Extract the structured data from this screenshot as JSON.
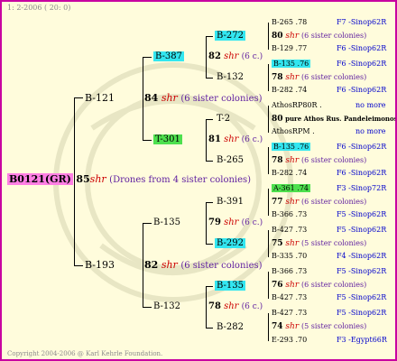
{
  "header": "1:  2-2006 ( 20: 0)",
  "footer": "Copyright 2004-2006 @ Karl Kehrle Foundation.",
  "root": {
    "name": "B0121(GR)",
    "year": "85",
    "shr": "shr",
    "note": "(Drones from 4 sister colonies)"
  },
  "gen1": {
    "top": {
      "id": "B-121",
      "year": "84",
      "shr": "shr",
      "note": "(6 sister colonies)"
    },
    "bottom": {
      "id": "B-193",
      "year": "82",
      "shr": "shr",
      "note": "(6 sister colonies)"
    }
  },
  "gen2": {
    "a": {
      "id": "B-387",
      "year": "82",
      "shr": "shr",
      "note": "(6 c.)"
    },
    "b": {
      "id": "T-301",
      "year": "81",
      "shr": "shr",
      "note": "(6 c.)"
    },
    "c": {
      "id": "B-135",
      "year": "79",
      "shr": "shr",
      "note": "(6 c.)"
    },
    "d": {
      "id": "B-132",
      "year": "78",
      "shr": "shr",
      "note": "(6 c.)"
    }
  },
  "gen3": {
    "a1": "B-272",
    "a2": "B-132",
    "b1": "T-2",
    "b2": "B-265",
    "c1": "B-391",
    "c2": "B-292",
    "d1": "B-135",
    "d2": "B-282"
  },
  "rows": [
    {
      "l": "B-265 .78",
      "r": "F7 -Sinop62R"
    },
    {
      "y": "80",
      "shr": "shr",
      "n": "(6 sister colonies)"
    },
    {
      "l": "B-129 .77",
      "r": "F6 -Sinop62R"
    },
    {
      "l": "B-135 .76",
      "r": "F6 -Sinop62R"
    },
    {
      "y": "78",
      "shr": "shr",
      "n": "(6 sister colonies)"
    },
    {
      "l": "B-282 .74",
      "r": "F6 -Sinop62R"
    },
    {
      "l": "AthosRP80R .",
      "r": "no more"
    },
    {
      "y": "80",
      "t": "pure Athos Rus. Pandeleimonos"
    },
    {
      "l": "AthosRPM .",
      "r": "no more"
    },
    {
      "l": "B-135 .76",
      "r": "F6 -Sinop62R"
    },
    {
      "y": "78",
      "shr": "shr",
      "n": "(6 sister colonies)"
    },
    {
      "l": "B-282 .74",
      "r": "F6 -Sinop62R"
    },
    {
      "l": "A-361 .74",
      "r": "F3 -Sinop72R"
    },
    {
      "y": "77",
      "shr": "shr",
      "n": "(6 sister colonies)"
    },
    {
      "l": "B-366 .73",
      "r": "F5 -Sinop62R"
    },
    {
      "l": "B-427 .73",
      "r": "F5 -Sinop62R"
    },
    {
      "y": "75",
      "shr": "shr",
      "n": "(5 sister colonies)"
    },
    {
      "l": "B-335 .70",
      "r": "F4 -Sinop62R"
    },
    {
      "l": "B-366 .73",
      "r": "F5 -Sinop62R"
    },
    {
      "y": "76",
      "shr": "shr",
      "n": "(6 sister colonies)"
    },
    {
      "l": "B-427 .73",
      "r": "F5 -Sinop62R"
    },
    {
      "l": "B-427 .73",
      "r": "F5 -Sinop62R"
    },
    {
      "y": "74",
      "shr": "shr",
      "n": "(5 sister colonies)"
    },
    {
      "l": "E-293 .70",
      "r": "F3 -Egypt66R"
    }
  ],
  "colors": {
    "frame": "#c800a0",
    "background": "#fffcdc",
    "cyan": "#33e6f0",
    "green": "#4ee04e",
    "pink": "#ff7fe4",
    "shr": "#cc0000",
    "link": "#0000cc"
  }
}
